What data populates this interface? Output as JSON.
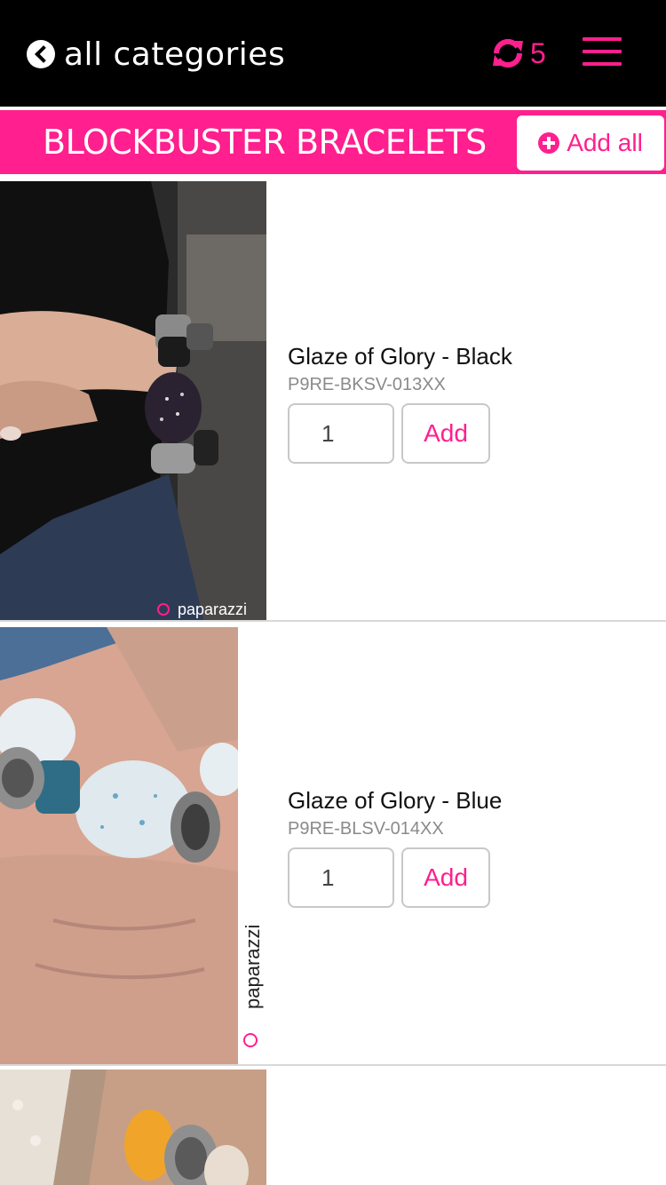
{
  "header": {
    "back_label": "all categories",
    "sync_count": "5",
    "accent_color": "#ff1f8e"
  },
  "category": {
    "title": "BLOCKBUSTER BRACELETS",
    "add_all_label": "Add all"
  },
  "products": [
    {
      "name": "Glaze of Glory - Black",
      "sku": "P9RE-BKSV-013XX",
      "quantity": "1",
      "add_label": "Add",
      "watermark": "paparazzi"
    },
    {
      "name": "Glaze of Glory - Blue",
      "sku": "P9RE-BLSV-014XX",
      "quantity": "1",
      "add_label": "Add",
      "watermark": "paparazzi"
    }
  ],
  "icons": {
    "back": "chevron-left-circle-icon",
    "sync": "refresh-icon",
    "menu": "hamburger-menu-icon",
    "add_all": "plus-circle-icon"
  }
}
